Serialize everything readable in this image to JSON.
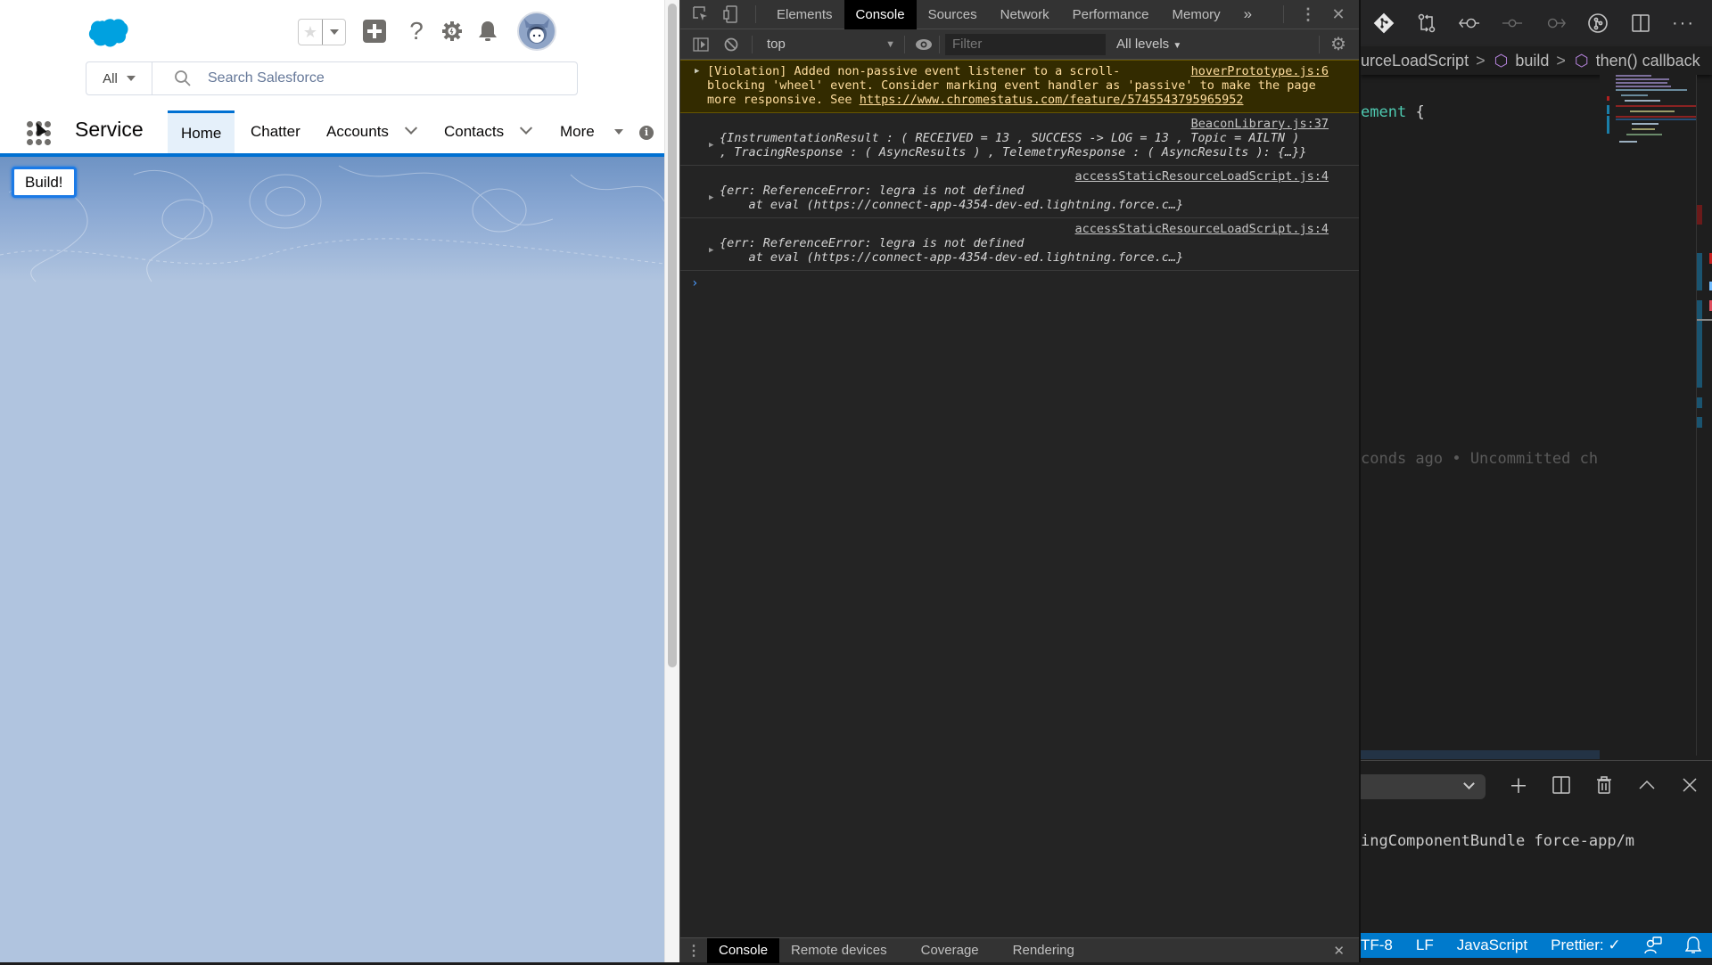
{
  "salesforce": {
    "app_name": "Service",
    "search": {
      "scope": "All",
      "placeholder": "Search Salesforce"
    },
    "header_icons": [
      "favorites-star-icon",
      "favorites-dropdown-icon",
      "global-actions-plus-icon",
      "help-icon",
      "setup-gear-icon",
      "notifications-bell-icon",
      "user-avatar"
    ],
    "nav": {
      "tabs": [
        {
          "label": "Home",
          "active": true,
          "has_menu": false
        },
        {
          "label": "Chatter",
          "active": false,
          "has_menu": false
        },
        {
          "label": "Accounts",
          "active": false,
          "has_menu": true
        },
        {
          "label": "Contacts",
          "active": false,
          "has_menu": true
        },
        {
          "label": "More",
          "active": false,
          "has_menu": true
        }
      ],
      "info_icon": "i"
    },
    "build_button": "Build!",
    "brand_color": "#0070d2"
  },
  "devtools": {
    "tabs": [
      {
        "label": "Elements",
        "active": false
      },
      {
        "label": "Console",
        "active": true
      },
      {
        "label": "Sources",
        "active": false
      },
      {
        "label": "Network",
        "active": false
      },
      {
        "label": "Performance",
        "active": false
      },
      {
        "label": "Memory",
        "active": false
      }
    ],
    "overflow": "»",
    "toolbar": {
      "context": "top",
      "filter_placeholder": "Filter",
      "levels": "All levels"
    },
    "messages": [
      {
        "type": "violation",
        "source": "hoverPrototype.js:6",
        "text_line1": "[Violation] Added non-passive event listener to a scroll-",
        "text_line2": "blocking 'wheel' event. Consider marking event handler as 'passive' to make the page",
        "text_line3_prefix": "more responsive. See ",
        "link": "https://www.chromestatus.com/feature/5745543795965952"
      },
      {
        "type": "log",
        "source": "BeaconLibrary.js:37",
        "line1": "{InstrumentationResult :  ( RECEIVED = 13 , SUCCESS -> LOG = 13 , Topic = AILTN )",
        "line2": ", TracingResponse : ( AsyncResults ) , TelemetryResponse : ( AsyncResults ): {…}}"
      },
      {
        "type": "log",
        "source": "accessStaticResourceLoadScript.js:4",
        "line1": "{err: ReferenceError: legra is not defined",
        "line2": "    at eval (https://connect-app-4354-dev-ed.lightning.force.c…}"
      },
      {
        "type": "log",
        "source": "accessStaticResourceLoadScript.js:4",
        "line1": "{err: ReferenceError: legra is not defined",
        "line2": "    at eval (https://connect-app-4354-dev-ed.lightning.force.c…}"
      }
    ],
    "prompt": "›",
    "drawer_tabs": [
      {
        "label": "Console",
        "active": true
      },
      {
        "label": "Remote devices",
        "active": false
      },
      {
        "label": "Coverage",
        "active": false
      },
      {
        "label": "Rendering",
        "active": false
      }
    ]
  },
  "vscode": {
    "breadcrumbs": [
      "urceLoadScript",
      "build",
      "then() callback"
    ],
    "code_fragment": "ement",
    "code_brace": "{",
    "blame": "conds ago • Uncommitted ch",
    "terminal_line": "ingComponentBundle  force-app/m",
    "statusbar": {
      "encoding": "TF-8",
      "eol": "LF",
      "language": "JavaScript",
      "prettier": "Prettier: ✓"
    },
    "accent_color": "#007acc"
  }
}
